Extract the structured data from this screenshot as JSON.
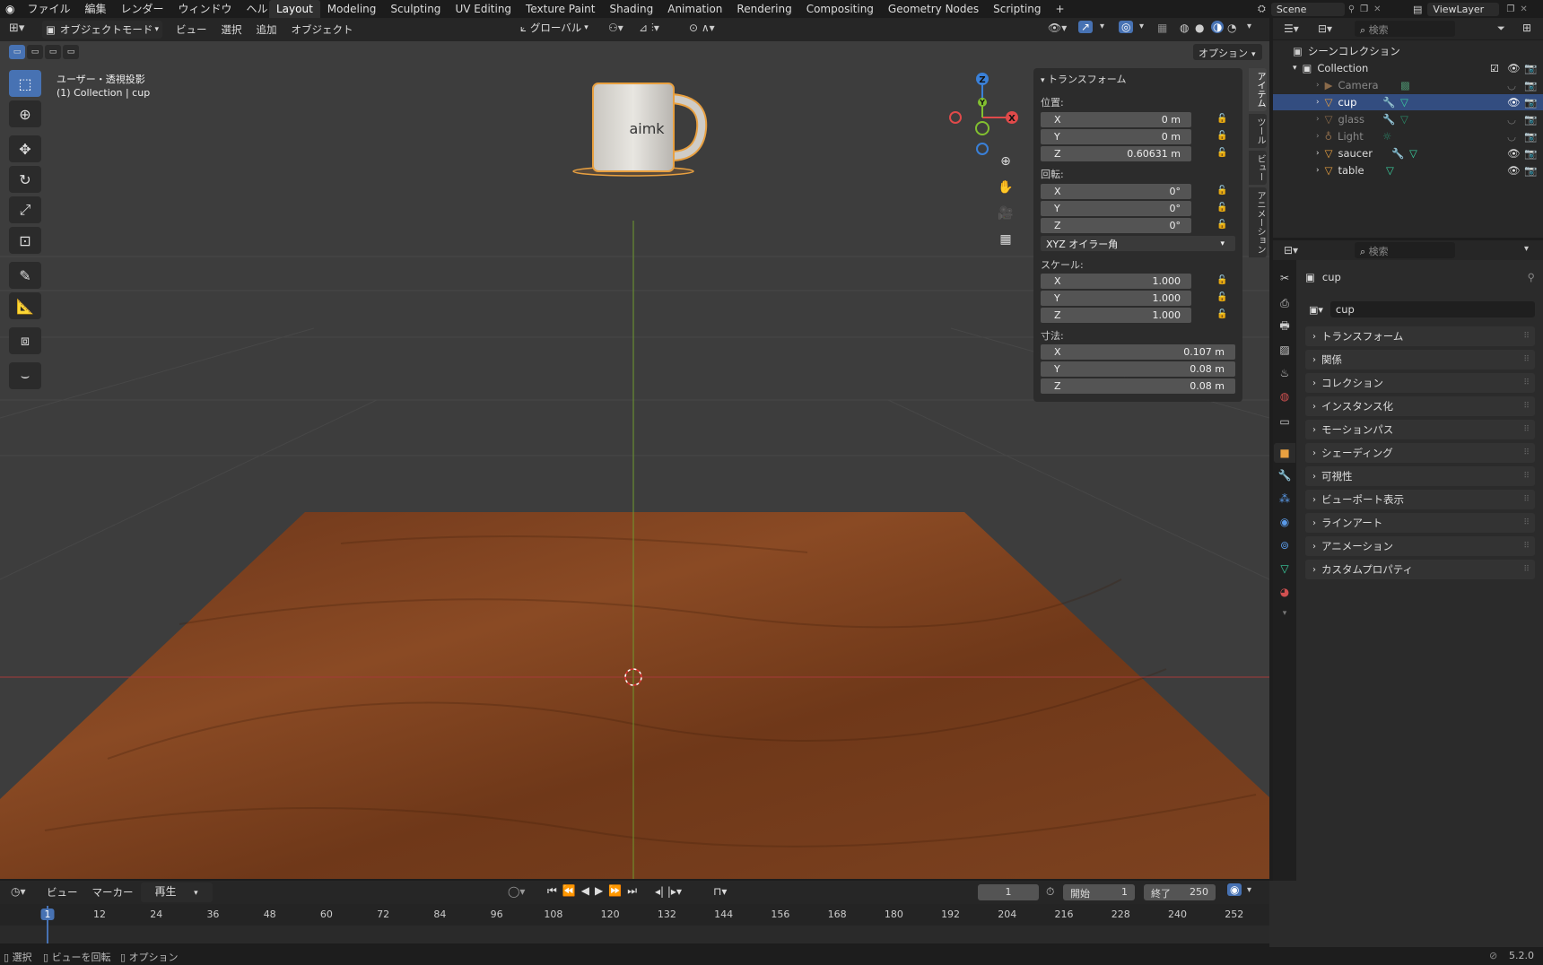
{
  "topbar": {
    "menus": [
      "ファイル",
      "編集",
      "レンダー",
      "ウィンドウ",
      "ヘルプ"
    ],
    "workspaces": [
      "Layout",
      "Modeling",
      "Sculpting",
      "UV Editing",
      "Texture Paint",
      "Shading",
      "Animation",
      "Rendering",
      "Compositing",
      "Geometry Nodes",
      "Scripting"
    ],
    "active_workspace": "Layout",
    "add_tab": "+",
    "scene": "Scene",
    "view_layer": "ViewLayer"
  },
  "viewport_header": {
    "mode": "オブジェクトモード",
    "menus": [
      "ビュー",
      "選択",
      "追加",
      "オブジェクト"
    ],
    "orientation": "グローバル",
    "options": "オプション"
  },
  "viewport": {
    "view_label": "ユーザー・透視投影",
    "object_label": "(1) Collection | cup",
    "mug_text": "aimk",
    "axis_x": "X",
    "axis_y": "Y",
    "axis_z": "Z"
  },
  "npanel": {
    "title": "トランスフォーム",
    "location_label": "位置:",
    "location": [
      {
        "axis": "X",
        "value": "0 m"
      },
      {
        "axis": "Y",
        "value": "0 m"
      },
      {
        "axis": "Z",
        "value": "0.60631 m"
      }
    ],
    "rotation_label": "回転:",
    "rotation": [
      {
        "axis": "X",
        "value": "0°"
      },
      {
        "axis": "Y",
        "value": "0°"
      },
      {
        "axis": "Z",
        "value": "0°"
      }
    ],
    "rotation_mode": "XYZ オイラー角",
    "scale_label": "スケール:",
    "scale": [
      {
        "axis": "X",
        "value": "1.000"
      },
      {
        "axis": "Y",
        "value": "1.000"
      },
      {
        "axis": "Z",
        "value": "1.000"
      }
    ],
    "dimensions_label": "寸法:",
    "dimensions": [
      {
        "axis": "X",
        "value": "0.107 m"
      },
      {
        "axis": "Y",
        "value": "0.08 m"
      },
      {
        "axis": "Z",
        "value": "0.08 m"
      }
    ],
    "tabs": [
      "アイテム",
      "ツール",
      "ビュー",
      "アニメーション"
    ]
  },
  "outliner": {
    "search_placeholder": "検索",
    "scene_collection": "シーンコレクション",
    "collection": "Collection",
    "objects": [
      {
        "name": "Camera",
        "selected": false,
        "dim": true
      },
      {
        "name": "cup",
        "selected": true,
        "dim": false
      },
      {
        "name": "glass",
        "selected": false,
        "dim": true
      },
      {
        "name": "Light",
        "selected": false,
        "dim": true
      },
      {
        "name": "saucer",
        "selected": false,
        "dim": false
      },
      {
        "name": "table",
        "selected": false,
        "dim": false
      }
    ]
  },
  "properties": {
    "search_placeholder": "検索",
    "object_name": "cup",
    "datablock_name": "cup",
    "sections": [
      "トランスフォーム",
      "関係",
      "コレクション",
      "インスタンス化",
      "モーションパス",
      "シェーディング",
      "可視性",
      "ビューポート表示",
      "ラインアート",
      "アニメーション",
      "カスタムプロパティ"
    ]
  },
  "timeline": {
    "menus": [
      "ビュー",
      "マーカー",
      "再生"
    ],
    "current_frame": "1",
    "start_label": "開始",
    "start": "1",
    "end_label": "終了",
    "end": "250",
    "ticks": [
      "1",
      "12",
      "24",
      "36",
      "48",
      "60",
      "72",
      "84",
      "96",
      "108",
      "120",
      "132",
      "144",
      "156",
      "168",
      "180",
      "192",
      "204",
      "216",
      "228",
      "240",
      "252"
    ]
  },
  "statusbar": {
    "select": "選択",
    "rotate_view": "ビューを回転",
    "options": "オプション",
    "version": "5.2.0"
  },
  "colors": {
    "accent": "#4772b3",
    "selected_row": "#334d80",
    "object_orange": "#e8a040",
    "axis_x": "#e04a4a",
    "axis_y": "#82c030",
    "axis_z": "#3a80d8",
    "table_wood": "#7a3e1e"
  }
}
